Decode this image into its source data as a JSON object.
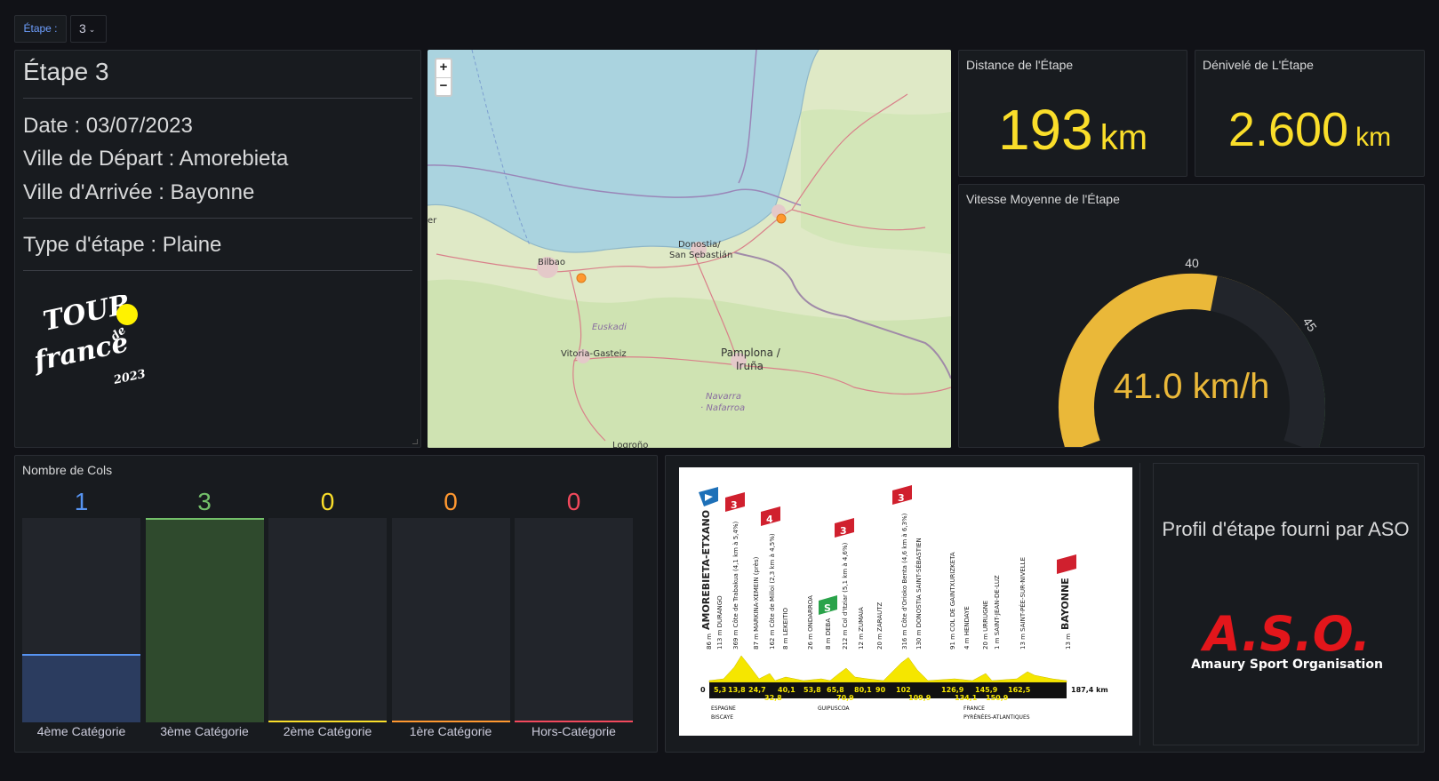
{
  "variable": {
    "label": "Étape :",
    "value": "3"
  },
  "info": {
    "title": "Étape 3",
    "date": "Date : 03/07/2023",
    "depart": "Ville de Départ : Amorebieta",
    "arrivee": "Ville d'Arrivée : Bayonne",
    "type": "Type d'étape : Plaine",
    "logo": {
      "line1": "TOUR",
      "line2": "de",
      "line3": "france",
      "year": "2023"
    }
  },
  "map": {
    "zoom_in": "+",
    "zoom_out": "−",
    "labels": [
      "Bilbao",
      "Donostia/\nSan Sebastián",
      "Euskadi",
      "Vitoria-Gasteiz",
      "Pamplona /\nIruña",
      "Navarra\n· Nafarroa",
      "Logroño",
      "er"
    ]
  },
  "distance": {
    "title": "Distance de l'Étape",
    "value": "193",
    "unit": "km"
  },
  "denivele": {
    "title": "Dénivelé de L'Étape",
    "value": "2.600",
    "unit": "km"
  },
  "vitesse": {
    "title": "Vitesse Moyenne de l'Étape",
    "value": 41.0,
    "display": "41.0 km/h",
    "min": 30,
    "max": 50,
    "thresholds": [
      {
        "from": 30,
        "to": 40,
        "color": "#e02f44"
      },
      {
        "from": 40,
        "to": 45,
        "color": "#eab839"
      },
      {
        "from": 45,
        "to": 50,
        "color": "#56a64b"
      }
    ],
    "gauge_color": "#eab839",
    "ticks": [
      "30",
      "40",
      "45",
      "50"
    ]
  },
  "cols": {
    "title": "Nombre de Cols",
    "max": 3,
    "items": [
      {
        "label": "4ème Catégorie",
        "value": 1,
        "display": "1",
        "color": "#5794f2",
        "fill": "#2b3c5f"
      },
      {
        "label": "3ème Catégorie",
        "value": 3,
        "display": "3",
        "color": "#73bf69",
        "fill": "#2f4a2d"
      },
      {
        "label": "2ème Catégorie",
        "value": 0,
        "display": "0",
        "color": "#fade2a",
        "fill": "#22252b"
      },
      {
        "label": "1ère Catégorie",
        "value": 0,
        "display": "0",
        "color": "#ff9830",
        "fill": "#22252b"
      },
      {
        "label": "Hors-Catégorie",
        "value": 0,
        "display": "0",
        "color": "#f2495c",
        "fill": "#22252b"
      }
    ]
  },
  "profile": {
    "start": "AMOREBIETA-ETXANO",
    "finish": "BAYONNE",
    "total": "187,4 km",
    "zero": "0",
    "waypoints": [
      "86 m",
      "113 m DURANGO",
      "369 m Côte de Trabakua (4,1 km à 5,4%)",
      "87 m MARKINA-XEMEIN (près)",
      "162 m Côte de Milloi (2,3 km à 4,5%)",
      "8 m LEKEITIO",
      "26 m ONDARROA",
      "8 m DEBA",
      "212 m Col d'Itziar (5,1 km à 4,6%)",
      "12 m ZUMAIA",
      "20 m ZARAUTZ",
      "316 m Côte d'Orioko Benta (4,6 km à 6,3%)",
      "130 m DONOSTIA SAINT-SÉBASTIEN",
      "91 m COL DE GAINTXURIZKETA",
      "4 m HENDAYE",
      "20 m URRUGNE",
      "1 m SAINT-JEAN-DE-LUZ",
      "13 m SAINT-PÉE-SUR-NIVELLE",
      "13 m"
    ],
    "km_top": [
      "5,3",
      "13,8",
      "24,7",
      "40,1",
      "53,8",
      "65,8",
      "80,1",
      "90",
      "102",
      "126,9",
      "145,9",
      "162,5"
    ],
    "km_bottom": [
      "32,8",
      "70,9",
      "109,9",
      "134,1",
      "150,9"
    ],
    "regions_left": [
      "ESPAGNE",
      "BISCAYE"
    ],
    "regions_mid": [
      "GUIPUSCOA"
    ],
    "regions_right": [
      "FRANCE",
      "PYRÉNÉES-ATLANTIQUES"
    ],
    "climbs": [
      "3",
      "4",
      "3",
      "3"
    ],
    "sprint": "S",
    "aso_caption": "Profil d'étape fourni par ASO",
    "aso_logo": "A.S.O.",
    "aso_sub": "Amaury Sport Organisation"
  }
}
